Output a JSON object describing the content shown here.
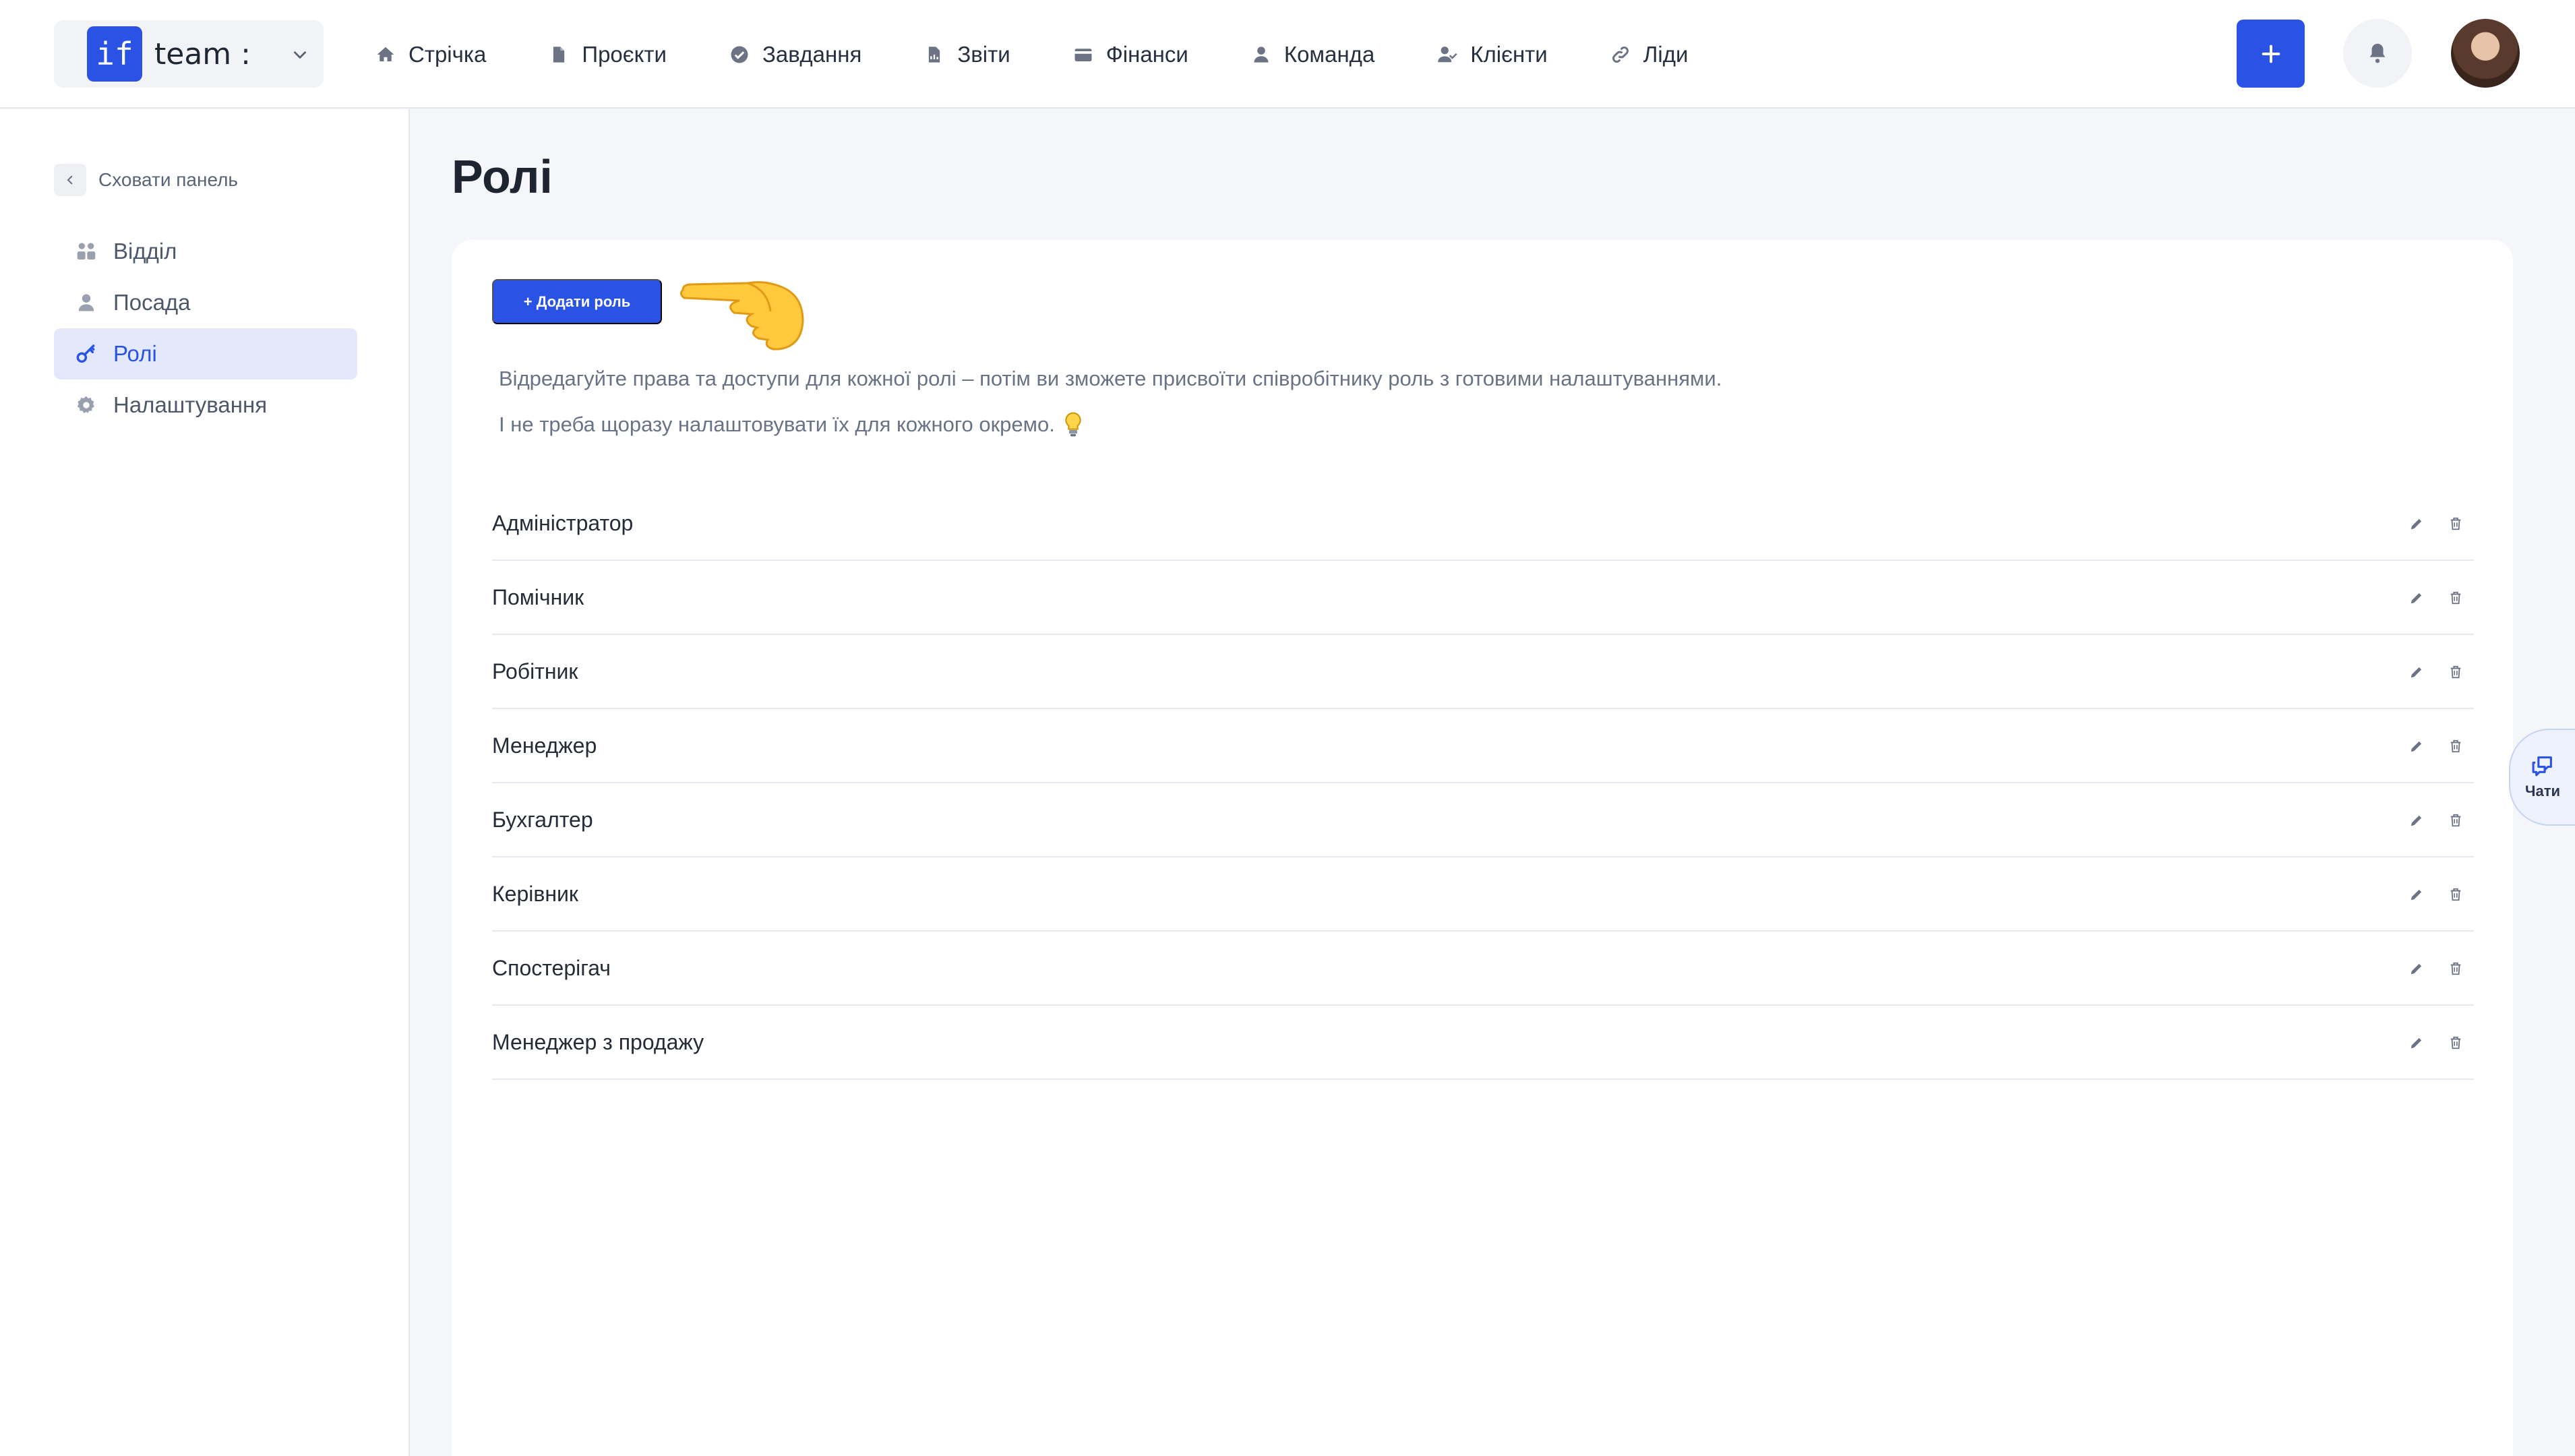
{
  "workspace": {
    "logo_text": "if",
    "name": "team :"
  },
  "nav": {
    "items": [
      {
        "label": "Стрічка",
        "icon": "home-icon"
      },
      {
        "label": "Проєкти",
        "icon": "document-icon"
      },
      {
        "label": "Завдання",
        "icon": "check-circle-icon"
      },
      {
        "label": "Звіти",
        "icon": "report-icon"
      },
      {
        "label": "Фінанси",
        "icon": "wallet-icon"
      },
      {
        "label": "Команда",
        "icon": "user-icon"
      },
      {
        "label": "Клієнти",
        "icon": "clients-icon"
      },
      {
        "label": "Ліди",
        "icon": "link-icon"
      }
    ]
  },
  "sidebar": {
    "hide_label": "Сховати панель",
    "items": [
      {
        "label": "Відділ",
        "icon": "department-icon",
        "active": false
      },
      {
        "label": "Посада",
        "icon": "person-icon",
        "active": false
      },
      {
        "label": "Ролі",
        "icon": "key-icon",
        "active": true
      },
      {
        "label": "Налаштування",
        "icon": "gear-icon",
        "active": false
      }
    ]
  },
  "page": {
    "title": "Ролі",
    "add_button": "+ Додати роль",
    "description_line1": "Відредагуйте права та доступи для кожної ролі – потім ви зможете присвоїти співробітнику роль з готовими налаштуваннями.",
    "description_line2": "І не треба щоразу налаштовувати їх для кожного окремо."
  },
  "roles": [
    "Адміністратор",
    "Помічник",
    "Робітник",
    "Менеджер",
    "Бухгалтер",
    "Керівник",
    "Спостерігач",
    "Менеджер з продажу"
  ],
  "chat_tab": {
    "label": "Чати"
  },
  "colors": {
    "accent": "#2a53e6",
    "active_bg": "#e3e9fb",
    "page_bg": "#f4f6f9"
  }
}
